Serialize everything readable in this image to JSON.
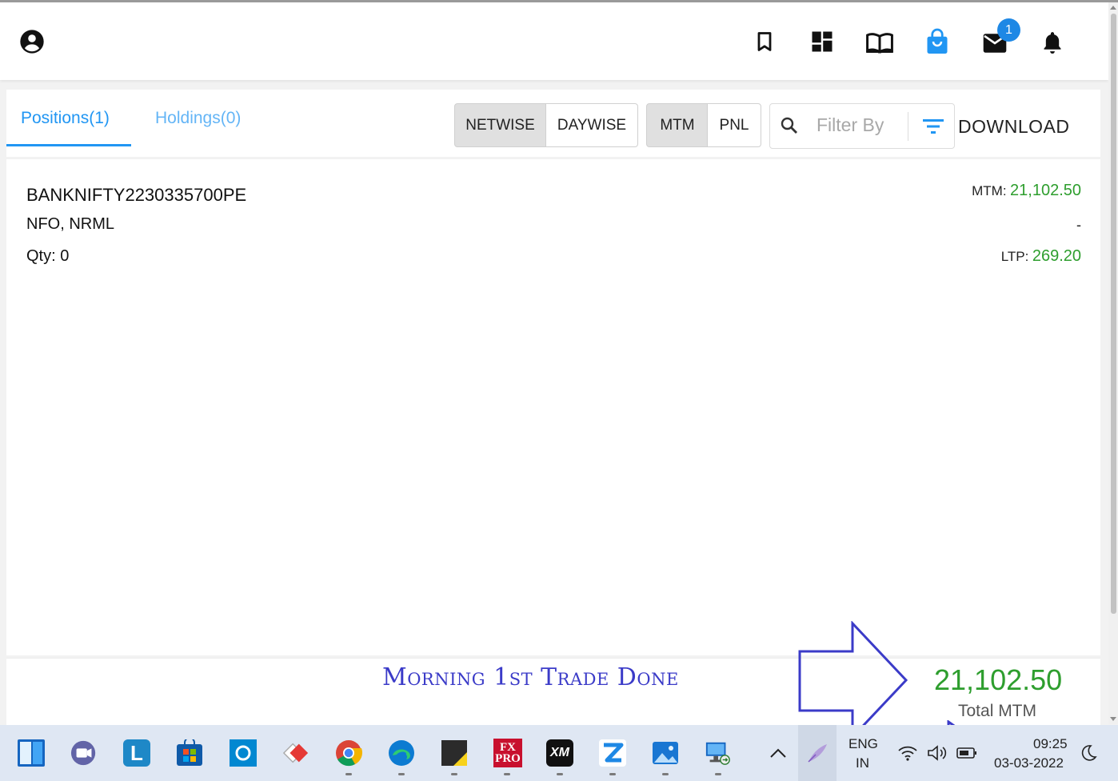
{
  "header": {
    "icons": [
      "account-circle-icon",
      "bookmark-icon",
      "dashboard-icon",
      "book-icon",
      "shopping-bag-icon",
      "mail-icon",
      "bell-icon"
    ],
    "mail_badge": "1"
  },
  "tabs": [
    {
      "label": "Positions(1)",
      "active": true
    },
    {
      "label": "Holdings(0)",
      "active": false
    }
  ],
  "toolbar": {
    "netwise": "NETWISE",
    "daywise": "DAYWISE",
    "mtm": "MTM",
    "pnl": "PNL",
    "filter_placeholder": "Filter By",
    "download": "DOWNLOAD"
  },
  "position": {
    "symbol": "BANKNIFTY2230335700PE",
    "exchange_product": "NFO, NRML",
    "qty_label": "Qty:",
    "qty_value": "0",
    "mtm_label": "MTM:",
    "mtm_value": "21,102.50",
    "dash": "-",
    "ltp_label": "LTP:",
    "ltp_value": "269.20"
  },
  "footer": {
    "annotation": "Morning 1st Trade Done",
    "total_value": "21,102.50",
    "total_label": "Total MTM"
  },
  "taskbar": {
    "apps": [
      "windows-start",
      "teams-chat",
      "l-app",
      "microsoft-store",
      "cortana",
      "red-diamond-app",
      "chrome",
      "edge",
      "sticky-notes",
      "fxpro",
      "xm",
      "zerodha",
      "photos",
      "remote-desktop"
    ],
    "fxpro_label": "FX PRO",
    "xm_label": "XM",
    "l_label": "L",
    "lang": "ENG",
    "region": "IN",
    "time": "09:25",
    "date": "03-03-2022"
  },
  "colors": {
    "accent": "#2196f3",
    "positive": "#2e9e2e",
    "annotation": "#3b3bc8"
  }
}
